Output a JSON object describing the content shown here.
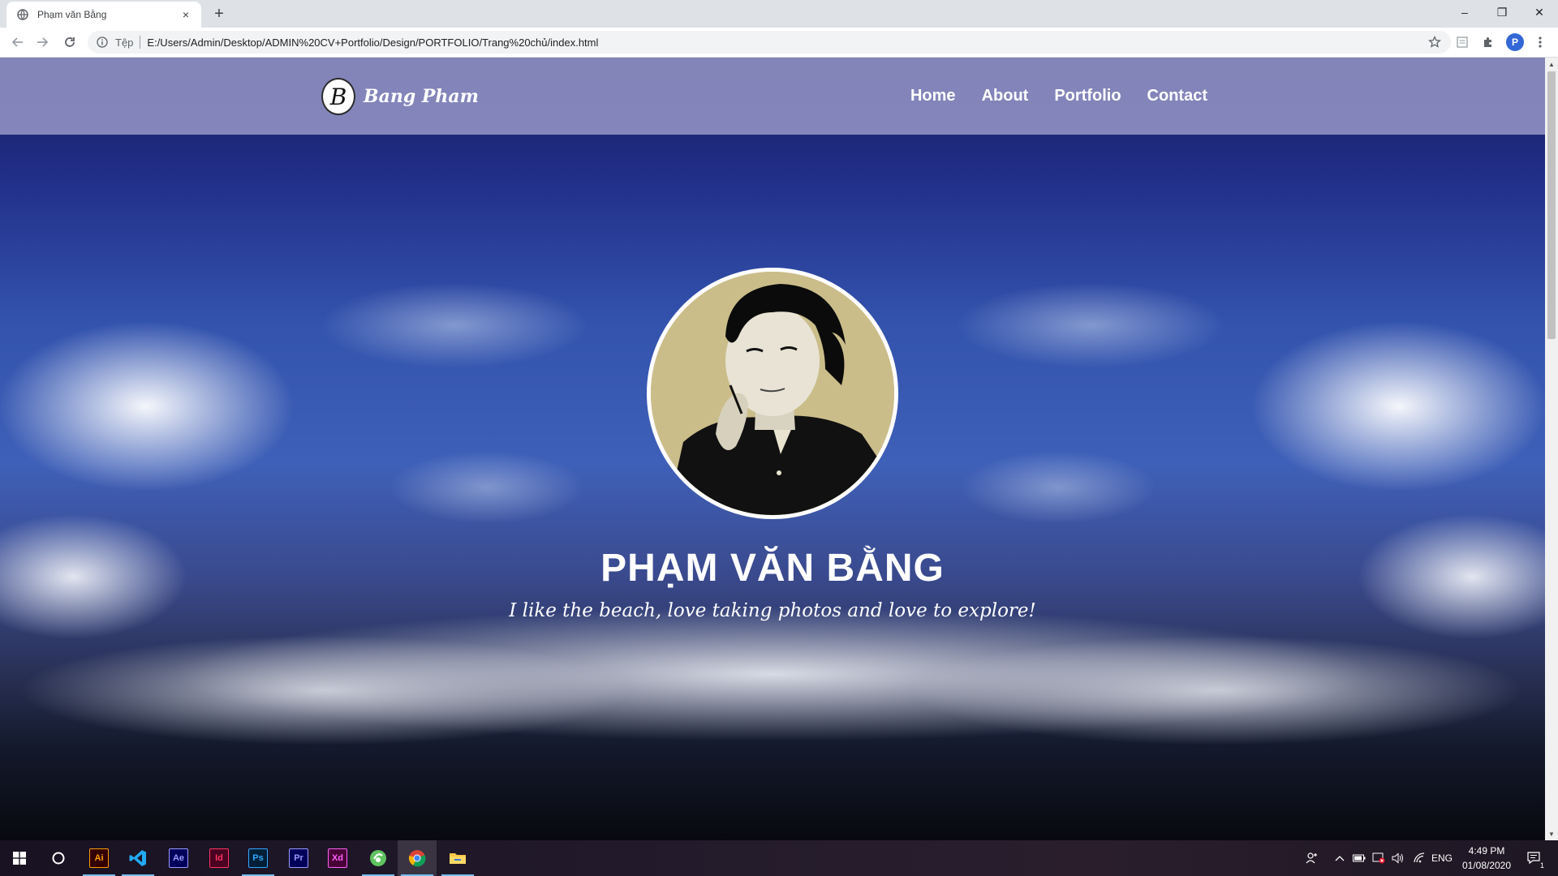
{
  "browser": {
    "tab_title": "Phạm văn Bằng",
    "tab_close": "×",
    "new_tab": "+",
    "window_controls": {
      "minimize": "–",
      "maximize": "❐",
      "close": "✕"
    },
    "omnibox": {
      "scheme_label": "Tệp",
      "url": "E:/Users/Admin/Desktop/ADMIN%20CV+Portfolio/Design/PORTFOLIO/Trang%20chủ/index.html"
    },
    "profile_initial": "P"
  },
  "page": {
    "logo_mark": "B",
    "logo_text": "Bang Pham",
    "nav": [
      {
        "label": "Home"
      },
      {
        "label": "About"
      },
      {
        "label": "Portfolio"
      },
      {
        "label": "Contact"
      }
    ],
    "hero": {
      "name": "PHẠM VĂN BẰNG",
      "tagline": "I like the beach, love taking photos and love to explore!"
    }
  },
  "taskbar": {
    "apps": [
      {
        "name": "illustrator",
        "label": "Ai",
        "color": "#ff9a00",
        "bg": "#330000"
      },
      {
        "name": "vscode",
        "label": "",
        "color": "#23a9f2",
        "bg": "transparent"
      },
      {
        "name": "after-effects",
        "label": "Ae",
        "color": "#9999ff",
        "bg": "#00005b"
      },
      {
        "name": "indesign",
        "label": "Id",
        "color": "#ff3366",
        "bg": "#49021f"
      },
      {
        "name": "photoshop",
        "label": "Ps",
        "color": "#31a8ff",
        "bg": "#001e36"
      },
      {
        "name": "premiere",
        "label": "Pr",
        "color": "#9999ff",
        "bg": "#00005b"
      },
      {
        "name": "xd",
        "label": "Xd",
        "color": "#ff61f6",
        "bg": "#470137"
      },
      {
        "name": "app-green",
        "label": "",
        "color": "#5fc35f",
        "bg": "transparent"
      },
      {
        "name": "chrome",
        "label": "",
        "color": "#4285f4",
        "bg": "transparent"
      },
      {
        "name": "file-explorer",
        "label": "",
        "color": "#f7c948",
        "bg": "transparent"
      }
    ],
    "language": "ENG",
    "time": "4:49 PM",
    "date": "01/08/2020",
    "notification_count": "1"
  }
}
